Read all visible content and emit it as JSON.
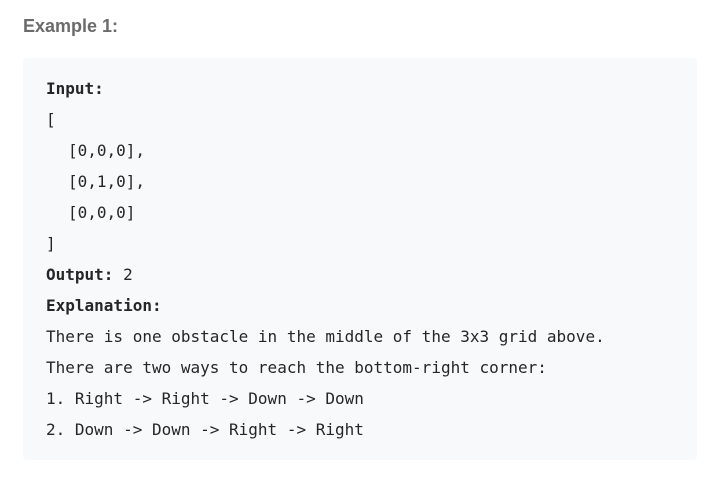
{
  "heading": "Example 1:",
  "input": {
    "label": "Input:",
    "open_bracket": "[",
    "rows": [
      "[0,0,0],",
      "[0,1,0],",
      "[0,0,0]"
    ],
    "close_bracket": "]"
  },
  "output": {
    "label": "Output:",
    "value": " 2"
  },
  "explanation": {
    "label": "Explanation:",
    "lines": [
      "There is one obstacle in the middle of the 3x3 grid above.",
      "There are two ways to reach the bottom-right corner:",
      "1. Right -> Right -> Down -> Down",
      "2. Down -> Down -> Right -> Right"
    ]
  }
}
